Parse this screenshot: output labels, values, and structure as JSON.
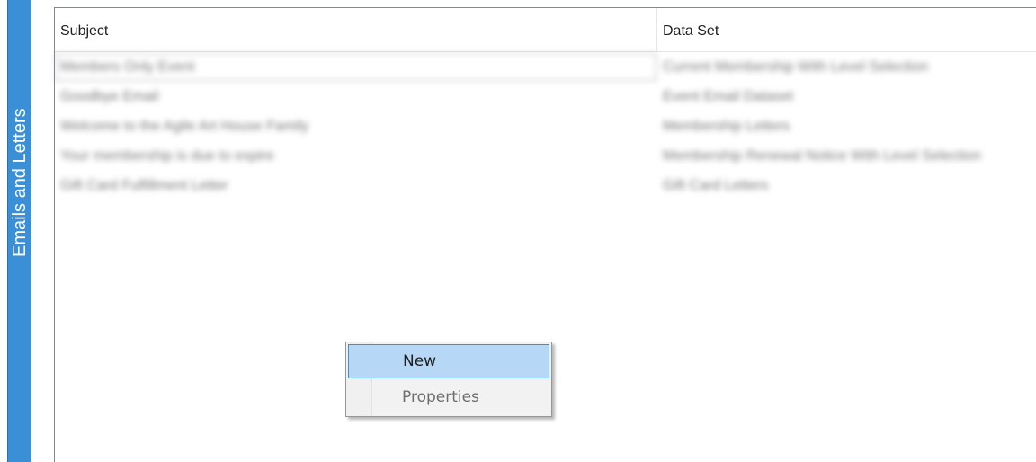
{
  "side_panel": {
    "label": "Emails and Letters",
    "color": "#3a8fd6"
  },
  "list": {
    "columns": [
      "Subject",
      "Data Set"
    ],
    "rows": [
      {
        "subject": "Members Only Event",
        "data_set": "Current Membership With Level Selection"
      },
      {
        "subject": "Goodbye Email",
        "data_set": "Event Email Dataset"
      },
      {
        "subject": "Welcome to the Agile Art House Family",
        "data_set": "Membership Letters"
      },
      {
        "subject": "Your membership is due to expire",
        "data_set": "Membership Renewal Notice With Level Selection"
      },
      {
        "subject": "Gift Card Fulfillment Letter",
        "data_set": "Gift Card Letters"
      }
    ]
  },
  "context_menu": {
    "items": [
      {
        "label": "New",
        "highlighted": true
      },
      {
        "label": "Properties",
        "highlighted": false
      }
    ],
    "highlight_color": "#b6d7f5"
  }
}
